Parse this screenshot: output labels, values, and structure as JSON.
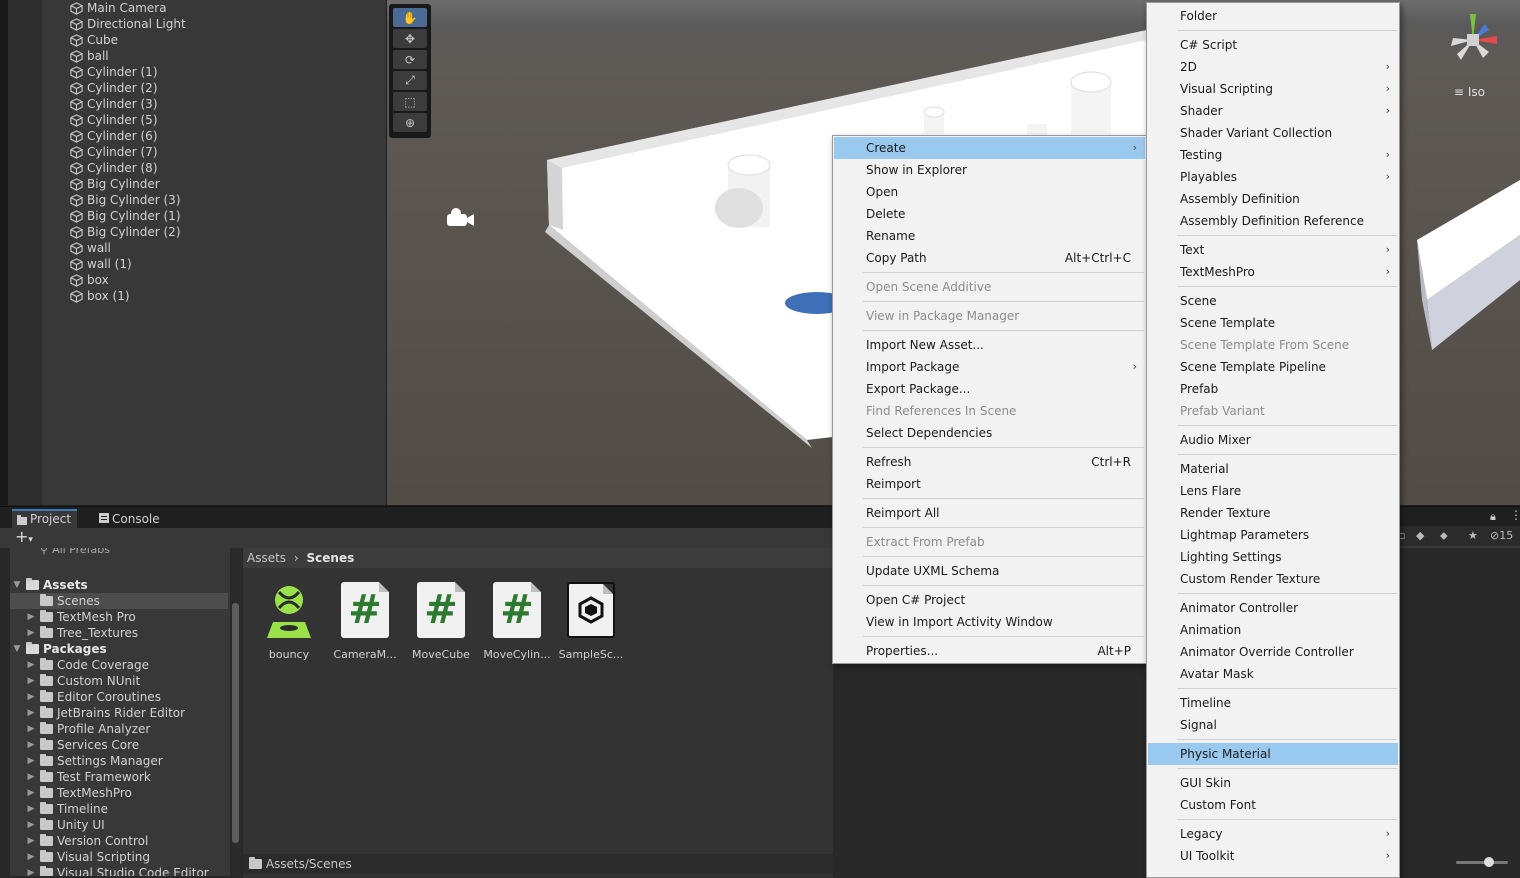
{
  "hierarchy": {
    "items": [
      "Main Camera",
      "Directional Light",
      "Cube",
      "ball",
      "Cylinder (1)",
      "Cylinder (2)",
      "Cylinder (3)",
      "Cylinder (5)",
      "Cylinder (6)",
      "Cylinder (7)",
      "Cylinder (8)",
      "Big Cylinder",
      "Big Cylinder (3)",
      "Big Cylinder (1)",
      "Big Cylinder (2)",
      "wall",
      "wall (1)",
      "box",
      "box (1)"
    ]
  },
  "scene": {
    "view_mode": "Iso"
  },
  "project": {
    "tabs": [
      "Project",
      "Console"
    ],
    "search_hint": "All Prefabs",
    "tree": {
      "assets_label": "Assets",
      "assets_children": [
        "Scenes",
        "TextMesh Pro",
        "Tree_Textures"
      ],
      "packages_label": "Packages",
      "packages_children": [
        "Code Coverage",
        "Custom NUnit",
        "Editor Coroutines",
        "JetBrains Rider Editor",
        "Profile Analyzer",
        "Services Core",
        "Settings Manager",
        "Test Framework",
        "TextMeshPro",
        "Timeline",
        "Unity UI",
        "Version Control",
        "Visual Scripting",
        "Visual Studio Code Editor"
      ]
    },
    "breadcrumb": {
      "root": "Assets",
      "current": "Scenes"
    },
    "assets": [
      "bouncy",
      "CameraM...",
      "MoveCube",
      "MoveCylin...",
      "SampleSc..."
    ],
    "path": "Assets/Scenes",
    "hidden_count": "15"
  },
  "context_menu": {
    "items": [
      {
        "label": "Create",
        "shortcut": "",
        "submenu": true,
        "state": "highlight"
      },
      {
        "label": "Show in Explorer",
        "shortcut": "",
        "submenu": false,
        "state": "normal"
      },
      {
        "label": "Open",
        "shortcut": "",
        "submenu": false,
        "state": "normal"
      },
      {
        "label": "Delete",
        "shortcut": "",
        "submenu": false,
        "state": "normal"
      },
      {
        "label": "Rename",
        "shortcut": "",
        "submenu": false,
        "state": "normal"
      },
      {
        "label": "Copy Path",
        "shortcut": "Alt+Ctrl+C",
        "submenu": false,
        "state": "normal"
      },
      {
        "label": "Open Scene Additive",
        "shortcut": "",
        "submenu": false,
        "state": "disabled"
      },
      {
        "label": "View in Package Manager",
        "shortcut": "",
        "submenu": false,
        "state": "disabled"
      },
      {
        "label": "Import New Asset...",
        "shortcut": "",
        "submenu": false,
        "state": "normal"
      },
      {
        "label": "Import Package",
        "shortcut": "",
        "submenu": true,
        "state": "normal"
      },
      {
        "label": "Export Package...",
        "shortcut": "",
        "submenu": false,
        "state": "normal"
      },
      {
        "label": "Find References In Scene",
        "shortcut": "",
        "submenu": false,
        "state": "disabled"
      },
      {
        "label": "Select Dependencies",
        "shortcut": "",
        "submenu": false,
        "state": "normal"
      },
      {
        "label": "Refresh",
        "shortcut": "Ctrl+R",
        "submenu": false,
        "state": "normal"
      },
      {
        "label": "Reimport",
        "shortcut": "",
        "submenu": false,
        "state": "normal"
      },
      {
        "label": "Reimport All",
        "shortcut": "",
        "submenu": false,
        "state": "normal"
      },
      {
        "label": "Extract From Prefab",
        "shortcut": "",
        "submenu": false,
        "state": "disabled"
      },
      {
        "label": "Update UXML Schema",
        "shortcut": "",
        "submenu": false,
        "state": "normal"
      },
      {
        "label": "Open C# Project",
        "shortcut": "",
        "submenu": false,
        "state": "normal"
      },
      {
        "label": "View in Import Activity Window",
        "shortcut": "",
        "submenu": false,
        "state": "normal"
      },
      {
        "label": "Properties...",
        "shortcut": "Alt+P",
        "submenu": false,
        "state": "normal"
      }
    ]
  },
  "create_menu": {
    "items": [
      {
        "label": "Folder",
        "submenu": false,
        "state": "normal"
      },
      {
        "label": "C# Script",
        "submenu": false,
        "state": "normal"
      },
      {
        "label": "2D",
        "submenu": true,
        "state": "normal"
      },
      {
        "label": "Visual Scripting",
        "submenu": true,
        "state": "normal"
      },
      {
        "label": "Shader",
        "submenu": true,
        "state": "normal"
      },
      {
        "label": "Shader Variant Collection",
        "submenu": false,
        "state": "normal"
      },
      {
        "label": "Testing",
        "submenu": true,
        "state": "normal"
      },
      {
        "label": "Playables",
        "submenu": true,
        "state": "normal"
      },
      {
        "label": "Assembly Definition",
        "submenu": false,
        "state": "normal"
      },
      {
        "label": "Assembly Definition Reference",
        "submenu": false,
        "state": "normal"
      },
      {
        "label": "Text",
        "submenu": true,
        "state": "normal"
      },
      {
        "label": "TextMeshPro",
        "submenu": true,
        "state": "normal"
      },
      {
        "label": "Scene",
        "submenu": false,
        "state": "normal"
      },
      {
        "label": "Scene Template",
        "submenu": false,
        "state": "normal"
      },
      {
        "label": "Scene Template From Scene",
        "submenu": false,
        "state": "disabled"
      },
      {
        "label": "Scene Template Pipeline",
        "submenu": false,
        "state": "normal"
      },
      {
        "label": "Prefab",
        "submenu": false,
        "state": "normal"
      },
      {
        "label": "Prefab Variant",
        "submenu": false,
        "state": "disabled"
      },
      {
        "label": "Audio Mixer",
        "submenu": false,
        "state": "normal"
      },
      {
        "label": "Material",
        "submenu": false,
        "state": "normal"
      },
      {
        "label": "Lens Flare",
        "submenu": false,
        "state": "normal"
      },
      {
        "label": "Render Texture",
        "submenu": false,
        "state": "normal"
      },
      {
        "label": "Lightmap Parameters",
        "submenu": false,
        "state": "normal"
      },
      {
        "label": "Lighting Settings",
        "submenu": false,
        "state": "normal"
      },
      {
        "label": "Custom Render Texture",
        "submenu": false,
        "state": "normal"
      },
      {
        "label": "Animator Controller",
        "submenu": false,
        "state": "normal"
      },
      {
        "label": "Animation",
        "submenu": false,
        "state": "normal"
      },
      {
        "label": "Animator Override Controller",
        "submenu": false,
        "state": "normal"
      },
      {
        "label": "Avatar Mask",
        "submenu": false,
        "state": "normal"
      },
      {
        "label": "Timeline",
        "submenu": false,
        "state": "normal"
      },
      {
        "label": "Signal",
        "submenu": false,
        "state": "normal"
      },
      {
        "label": "Physic Material",
        "submenu": false,
        "state": "highlight"
      },
      {
        "label": "GUI Skin",
        "submenu": false,
        "state": "normal"
      },
      {
        "label": "Custom Font",
        "submenu": false,
        "state": "normal"
      },
      {
        "label": "Legacy",
        "submenu": true,
        "state": "normal"
      },
      {
        "label": "UI Toolkit",
        "submenu": true,
        "state": "normal"
      }
    ]
  },
  "colors": {
    "highlight": "#99c9ef",
    "accent_tab": "#3a79bb",
    "script_hash": "#2c7a30",
    "physic_icon": "#9be24a"
  }
}
